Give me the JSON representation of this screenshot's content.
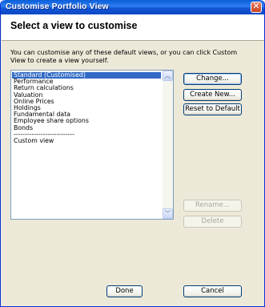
{
  "window": {
    "title": "Customise Portfolio View"
  },
  "header": {
    "title": "Select a view to customise"
  },
  "intro": "You can customise any of these default views, or you can click Custom View to create a view yourself.",
  "views": [
    "Standard (Customised)",
    "Performance",
    "Return calculations",
    "Valuation",
    "Online Prices",
    "Holdings",
    "Fundamental data",
    "Employee share options",
    "Bonds",
    "---------------------------",
    "Custom view"
  ],
  "selected_index": 0,
  "buttons": {
    "change": "Change...",
    "create_new": "Create New...",
    "reset_default": "Reset to Default",
    "rename": "Rename...",
    "delete": "Delete",
    "done": "Done",
    "cancel": "Cancel"
  }
}
